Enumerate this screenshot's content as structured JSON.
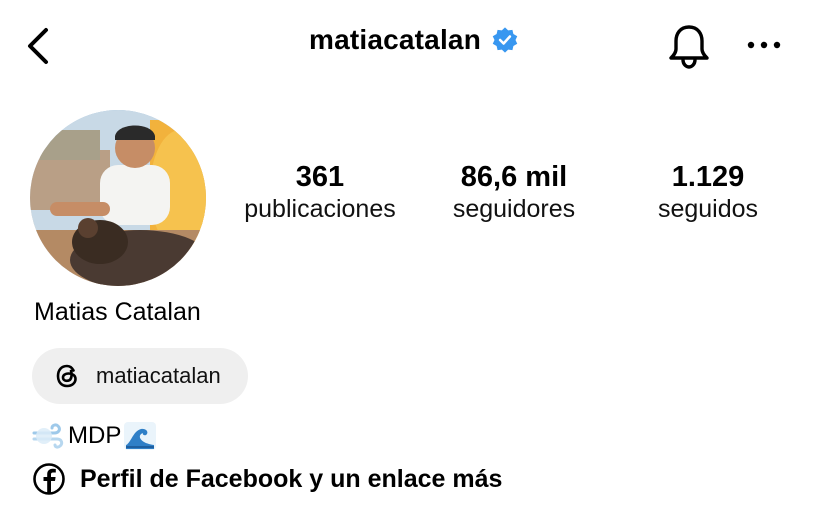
{
  "header": {
    "username": "matiacatalan",
    "verified": true,
    "icons": [
      "back-chevron-icon",
      "verified-badge-icon",
      "bell-icon",
      "more-dots-icon"
    ]
  },
  "stats": {
    "posts": {
      "count": "361",
      "label": "publicaciones"
    },
    "followers": {
      "count": "86,6 mil",
      "label": "seguidores"
    },
    "following": {
      "count": "1.129",
      "label": "seguidos"
    }
  },
  "profile": {
    "full_name": "Matias Catalan",
    "threads_handle": "matiacatalan",
    "bio_text": "MDP",
    "links_text": "Perfil de Facebook y un enlace más"
  },
  "colors": {
    "verified_blue": "#3897f0",
    "chip_background": "#efefef",
    "text": "#000000"
  }
}
